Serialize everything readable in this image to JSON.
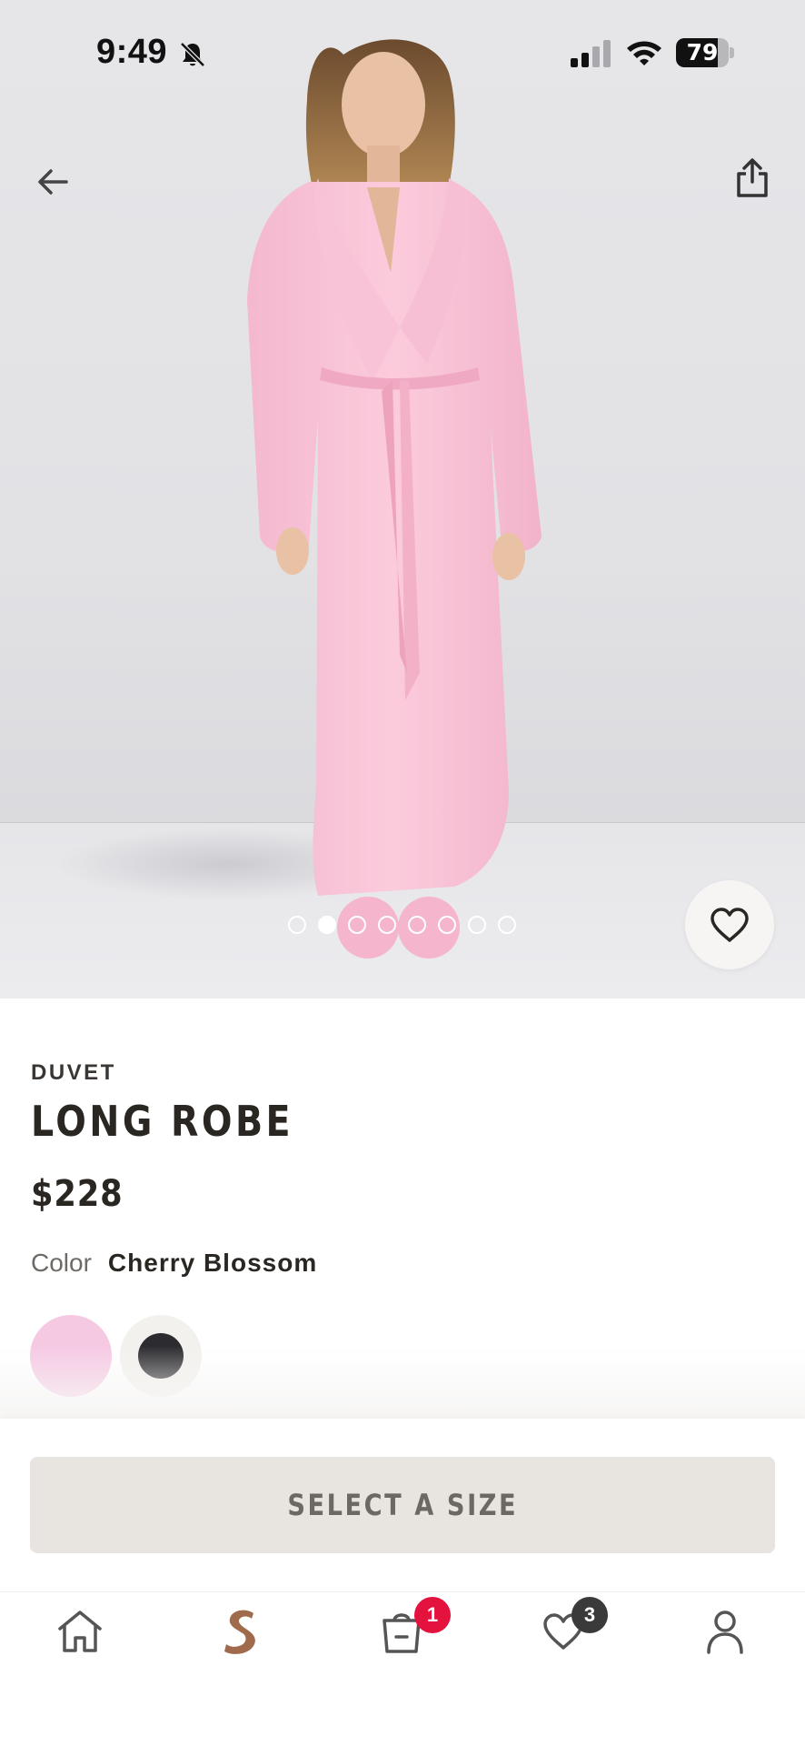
{
  "status_bar": {
    "time": "9:49",
    "battery": "79",
    "battery_level": 0.79,
    "icons": [
      "bell-slash-icon",
      "cellular-signal-icon",
      "wifi-icon",
      "battery-icon"
    ]
  },
  "hero": {
    "image": "product-photo",
    "carousel_total": 8,
    "carousel_active_index": 1,
    "icons": [
      "back-arrow-icon",
      "share-icon",
      "heart-icon"
    ]
  },
  "product": {
    "brand": "DUVET",
    "name": "LONG ROBE",
    "price": "$228",
    "color_label": "Color",
    "color_value": "Cherry Blossom",
    "swatches": [
      {
        "name": "Cherry Blossom",
        "color": "#f6c9e3",
        "selected": true
      },
      {
        "name": "dark",
        "color": "#2c2b2f",
        "selected": false
      }
    ]
  },
  "actions": {
    "select_size_label": "SELECT A SIZE"
  },
  "tab_bar": {
    "items": [
      {
        "id": "home",
        "icon": "home-icon"
      },
      {
        "id": "brand",
        "icon": "brand-logo-icon"
      },
      {
        "id": "bag",
        "icon": "shopping-bag-icon",
        "badge": "1"
      },
      {
        "id": "wishlist",
        "icon": "heart-icon",
        "badge": "3"
      },
      {
        "id": "account",
        "icon": "person-icon"
      }
    ]
  },
  "colors": {
    "accent_badge": "#e3133e",
    "text_primary": "#2a2622",
    "button_bg": "#e8e5e1"
  }
}
